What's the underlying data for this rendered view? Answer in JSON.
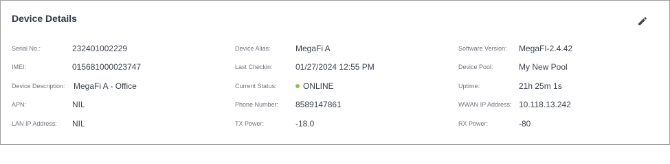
{
  "card": {
    "title": "Device Details",
    "edit_icon": "pencil-icon"
  },
  "fields": {
    "serial_no": {
      "label": "Serial No.:",
      "value": "232401002229"
    },
    "imei": {
      "label": "IMEI:",
      "value": "015681000023747"
    },
    "device_description": {
      "label": "Device Description:",
      "value": "MegaFi A - Office"
    },
    "apn": {
      "label": "APN:",
      "value": "NIL"
    },
    "lan_ip": {
      "label": "LAN IP Address:",
      "value": "NIL"
    },
    "device_alias": {
      "label": "Device Alias:",
      "value": "MegaFi A"
    },
    "last_checkin": {
      "label": "Last Checkin:",
      "value": "01/27/2024 12:55 PM"
    },
    "current_status": {
      "label": "Current Status:",
      "value": "ONLINE",
      "color": "#8bc34a"
    },
    "phone_number": {
      "label": "Phone Number:",
      "value": "8589147861"
    },
    "tx_power": {
      "label": "TX Power:",
      "value": "-18.0"
    },
    "software_version": {
      "label": "Software Version:",
      "value": "MegaFI-2.4.42"
    },
    "device_pool": {
      "label": "Device Pool:",
      "value": "My New Pool"
    },
    "uptime": {
      "label": "Uptime:",
      "value": "21h 25m 1s"
    },
    "wwan_ip": {
      "label": "WWAN IP Address:",
      "value": "10.118.13.242"
    },
    "rx_power": {
      "label": "RX Power:",
      "value": "-80"
    }
  }
}
